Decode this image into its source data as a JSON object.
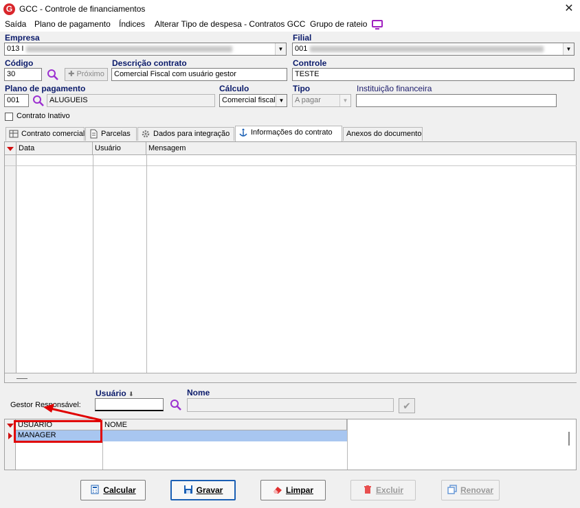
{
  "window": {
    "logo_letter": "G",
    "title": "GCC - Controle de financiamentos"
  },
  "menu": {
    "items": [
      "Saída",
      "Plano de pagamento",
      "Índices",
      "Alterar Tipo de despesa - Contratos GCC",
      "Grupo de rateio"
    ]
  },
  "form": {
    "empresa_label": "Empresa",
    "empresa_value": "013 I",
    "filial_label": "Filial",
    "filial_value": "001",
    "codigo_label": "Código",
    "codigo_value": "30",
    "proximo_label": "Próximo",
    "descricao_label": "Descrição contrato",
    "descricao_value": "Comercial Fiscal com usuário gestor",
    "controle_label": "Controle",
    "controle_value": "TESTE",
    "plano_label": "Plano de pagamento",
    "plano_code": "001",
    "plano_name": "ALUGUEIS",
    "calculo_label": "Cálculo",
    "calculo_value": "Comercial fiscal",
    "tipo_label": "Tipo",
    "tipo_value": "A pagar",
    "instituicao_label": "Instituição financeira",
    "instituicao_value": "",
    "contrato_inativo_label": "Contrato Inativo"
  },
  "tabs": [
    "Contrato comercial",
    "Parcelas",
    "Dados para integração",
    "Informações do contrato",
    "Anexos do documento"
  ],
  "grid": {
    "columns": [
      "Data",
      "Usuário",
      "Mensagem"
    ]
  },
  "gestor": {
    "label": "Gestor Responsável:",
    "usuario_label": "Usuário",
    "usuario_value": "",
    "nome_label": "Nome",
    "nome_value": ""
  },
  "gestor_grid": {
    "columns": [
      "USUÁRIO",
      "NOME"
    ],
    "rows": [
      {
        "usuario": "MANAGER",
        "nome": ""
      }
    ]
  },
  "buttons": {
    "calcular": "Calcular",
    "gravar": "Gravar",
    "limpar": "Limpar",
    "excluir": "Excluir",
    "renovar": "Renovar"
  },
  "colors": {
    "accent_red": "#d01010",
    "highlight": "#e00000",
    "selected_row": "#a8c6f0",
    "search_icon": "#9b2fd0"
  }
}
